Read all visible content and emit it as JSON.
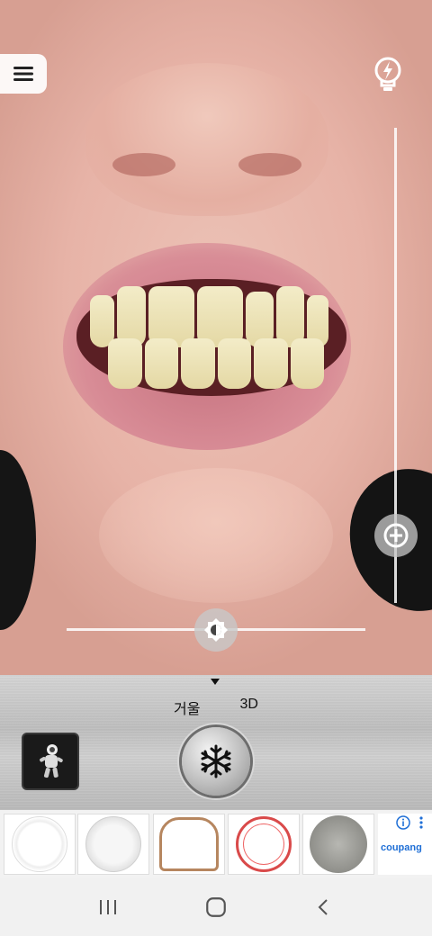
{
  "overlay": {
    "menu_icon": "hamburger-menu-icon",
    "flash_icon": "lightbulb-flash-icon",
    "zoom_icon": "zoom-plus-icon",
    "brightness_icon": "brightness-icon"
  },
  "panel": {
    "modes": [
      {
        "label": "거울"
      },
      {
        "label": "3D"
      }
    ],
    "gallery_icon": "astronaut-thumbnail",
    "shutter_icon": "snowflake-icon"
  },
  "ad": {
    "brand": "coupang",
    "info_icon": "info-icon",
    "more_icon": "more-vertical-icon"
  },
  "navbar": {
    "recent_icon": "recent-apps-icon",
    "home_icon": "home-icon",
    "back_icon": "back-icon"
  },
  "colors": {
    "panel_metal": "#c6c6c6",
    "coupang_blue": "#1f6fd6",
    "slider_track": "#ffffff"
  }
}
